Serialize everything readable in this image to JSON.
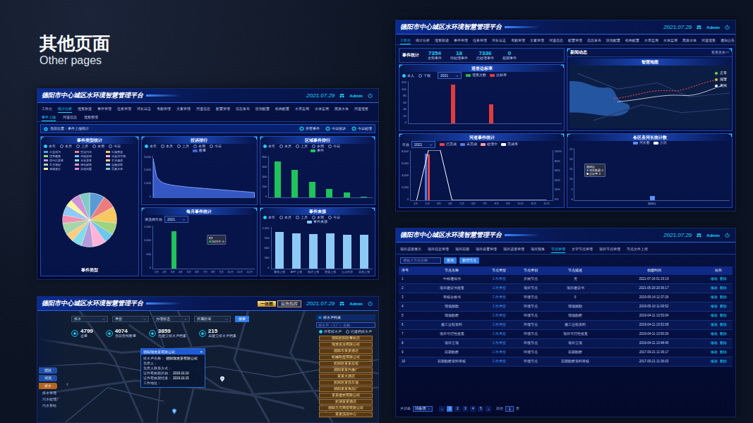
{
  "slide": {
    "title": "其他页面",
    "subtitle": "Other pages"
  },
  "platform": {
    "title": "德阳市中心城区水环境智慧管理平台",
    "date": "2021.07.29",
    "user": "Admin"
  },
  "screen_a": {
    "nav": [
      {
        "label": "工作台",
        "selected": false
      },
      {
        "label": "统计分析",
        "selected": true
      },
      {
        "label": "巡查轨迹",
        "selected": false
      },
      {
        "label": "事件管理",
        "selected": false
      },
      {
        "label": "任务管理",
        "selected": false
      },
      {
        "label": "河长日志",
        "selected": false
      },
      {
        "label": "考勤管理",
        "selected": false
      },
      {
        "label": "文案管理",
        "selected": false
      },
      {
        "label": "河道信息",
        "selected": false
      },
      {
        "label": "配置管理",
        "selected": false
      },
      {
        "label": "信息发布",
        "selected": false
      },
      {
        "label": "区划配置",
        "selected": false
      },
      {
        "label": "机构配置",
        "selected": false
      },
      {
        "label": "水质监测",
        "selected": false
      },
      {
        "label": "水体监测",
        "selected": false
      },
      {
        "label": "黑臭水体",
        "selected": false
      },
      {
        "label": "河道巡查",
        "selected": false
      }
    ],
    "subtabs": [
      {
        "label": "事件上报",
        "selected": true
      },
      {
        "label": "河道信息",
        "selected": false
      },
      {
        "label": "巡查整理",
        "selected": false
      }
    ],
    "breadcrumb": "当前位置：事件上报统计",
    "actions": [
      "所有事件",
      "今日投诉",
      "今日处理"
    ],
    "type_panel": {
      "title": "事件类型统计",
      "radios": [
        {
          "label": "本年",
          "selected": true
        },
        {
          "label": "本月",
          "selected": false
        },
        {
          "label": "上月",
          "selected": false
        },
        {
          "label": "本周",
          "selected": false
        },
        {
          "label": "今日",
          "selected": false
        }
      ],
      "caption": "事件类型",
      "slices": [
        {
          "label": "工业排污",
          "value": 9,
          "color": "#5b9bd5"
        },
        {
          "label": "生活污水",
          "value": 8,
          "color": "#ed7d7d"
        },
        {
          "label": "垃圾堆放",
          "value": 10,
          "color": "#f6c85f"
        },
        {
          "label": "违章建筑",
          "value": 7,
          "color": "#9fd47b"
        },
        {
          "label": "河道淤积",
          "value": 6,
          "color": "#6dc8ec"
        },
        {
          "label": "水面漂浮物",
          "value": 8,
          "color": "#ffb3d9"
        },
        {
          "label": "排污口异常",
          "value": 7,
          "color": "#b39ddb"
        },
        {
          "label": "水质异常",
          "value": 6,
          "color": "#80deea"
        },
        {
          "label": "非法捕捞",
          "value": 5,
          "color": "#ffcc80"
        },
        {
          "label": "非法采砂",
          "value": 7,
          "color": "#a5d6a7"
        },
        {
          "label": "绿化破坏",
          "value": 5,
          "color": "#f48fb1"
        },
        {
          "label": "设施损坏",
          "value": 6,
          "color": "#90caf9"
        },
        {
          "label": "岸线侵占",
          "value": 4,
          "color": "#fff59d"
        },
        {
          "label": "其他问题",
          "value": 6,
          "color": "#ce93d8"
        },
        {
          "label": "黑臭水体",
          "value": 6,
          "color": "#80cbc4"
        }
      ]
    },
    "rank_panel": {
      "title": "投诉排行",
      "radios": [
        {
          "label": "本年",
          "selected": true
        },
        {
          "label": "本月",
          "selected": false
        },
        {
          "label": "上月",
          "selected": false
        },
        {
          "label": "本周",
          "selected": false
        },
        {
          "label": "今日",
          "selected": false
        }
      ],
      "legend": [
        {
          "label": "数量",
          "color": "#3d63d8"
        }
      ],
      "y_ticks": [
        "3,000",
        "2,000",
        "1,000",
        "0"
      ],
      "values": [
        2800,
        1500,
        1200,
        1050,
        980,
        920,
        880,
        850,
        820,
        790,
        760,
        740,
        720,
        700,
        680,
        660,
        640,
        620,
        600,
        580,
        560,
        540,
        520,
        500,
        480,
        460,
        440,
        420,
        400,
        380
      ]
    },
    "region_panel": {
      "title": "区域事件排行",
      "radios": [
        {
          "label": "本年",
          "selected": true
        },
        {
          "label": "本月",
          "selected": false
        },
        {
          "label": "上月",
          "selected": false
        },
        {
          "label": "本周",
          "selected": false
        },
        {
          "label": "今日",
          "selected": false
        }
      ],
      "legend": [
        {
          "label": "事件",
          "color": "#1ec35b"
        }
      ],
      "y_ticks": [
        "800",
        "600",
        "400",
        "200",
        "0"
      ],
      "values": [
        690,
        520,
        300,
        160,
        90,
        20
      ]
    },
    "month_panel": {
      "title": "每月事件统计",
      "select_label": "请选择年份",
      "select_value": "2021",
      "y_ticks": [
        "1,500",
        "1,000",
        "500",
        "0"
      ],
      "months": [
        "1月",
        "2月",
        "3月",
        "4月",
        "5月",
        "6月",
        "7月",
        "8月",
        "9月",
        "10月",
        "11月",
        "12月"
      ],
      "values": [
        0,
        0,
        1300,
        0,
        0,
        0,
        0,
        0,
        0,
        0,
        0,
        0
      ],
      "tooltip": {
        "title": "8月",
        "text": "2021年: 0"
      }
    },
    "source_panel": {
      "title": "事件来源",
      "radios": [
        {
          "label": "本年",
          "selected": true
        },
        {
          "label": "本月",
          "selected": false
        },
        {
          "label": "上月",
          "selected": false
        },
        {
          "label": "本周",
          "selected": false
        },
        {
          "label": "今日",
          "selected": false
        }
      ],
      "legend": [
        {
          "label": "事件来源",
          "color": "#8ccaf5"
        }
      ],
      "y_ticks": [
        "1,200",
        "900",
        "600",
        "300",
        "0"
      ],
      "categories": [
        "微信上报",
        "APP上报",
        "电话上报",
        "巡查上报",
        "公众投诉",
        "其他上报"
      ],
      "values": [
        1050,
        1000,
        980,
        1000,
        970,
        960
      ]
    }
  },
  "screen_b": {
    "nav": [
      {
        "label": "工作台",
        "selected": true
      },
      {
        "label": "统计分析",
        "selected": false
      },
      {
        "label": "巡查轨迹",
        "selected": false
      },
      {
        "label": "事件管理",
        "selected": false
      },
      {
        "label": "任务管理",
        "selected": false
      },
      {
        "label": "河长日志",
        "selected": false
      },
      {
        "label": "考勤管理",
        "selected": false
      },
      {
        "label": "文案管理",
        "selected": false
      },
      {
        "label": "河道信息",
        "selected": false
      },
      {
        "label": "配置管理",
        "selected": false
      },
      {
        "label": "信息发布",
        "selected": false
      },
      {
        "label": "区划配置",
        "selected": false
      },
      {
        "label": "机构配置",
        "selected": false
      },
      {
        "label": "水质监测",
        "selected": false
      },
      {
        "label": "水体监测",
        "selected": false
      },
      {
        "label": "黑臭水体",
        "selected": false
      },
      {
        "label": "河道巡查",
        "selected": false
      },
      {
        "label": "通知公告",
        "selected": false
      }
    ],
    "stats": {
      "title": "事件统计",
      "items": [
        {
          "value": "7354",
          "label": "全部事件"
        },
        {
          "value": "18",
          "label": "待处理事件"
        },
        {
          "value": "7336",
          "label": "已处理事件"
        },
        {
          "value": "0",
          "label": "超期事件"
        }
      ]
    },
    "patrol": {
      "title": "巡查达标率",
      "radios": [
        {
          "label": "本人",
          "selected": true
        },
        {
          "label": "下级",
          "selected": false
        }
      ],
      "select_value": "2021",
      "legend": [
        {
          "label": "巡查次数",
          "color": "#2fb344"
        },
        {
          "label": "达标率",
          "color": "#e23b3b"
        }
      ],
      "y_ticks": [
        "120",
        "100",
        "80",
        "60",
        "40",
        "20",
        "0"
      ],
      "values": [
        0,
        0,
        0,
        110,
        0,
        0,
        55,
        0,
        0,
        0,
        0,
        0
      ]
    },
    "news": {
      "title": "新闻动态",
      "more": "查看更多>>"
    },
    "map": {
      "title": "智慧地图",
      "legend": [
        {
          "label": "正常",
          "color": "#7cd23c"
        },
        {
          "label": "报警",
          "color": "#e7b34a"
        },
        {
          "label": "离线",
          "color": "#ffffff"
        }
      ]
    },
    "river": {
      "title": "河道事件统计",
      "select_label": "年份",
      "select_value": "2021",
      "legend": [
        {
          "label": "已完成",
          "color": "#e8454a"
        },
        {
          "label": "未完成",
          "color": "#4f7be8"
        },
        {
          "label": "处理中",
          "color": "#ff9aa5"
        },
        {
          "label": "完成率",
          "color": "#ffffff"
        }
      ],
      "y_ticks": [
        "8,000",
        "6,000",
        "4,000",
        "2,000",
        "0"
      ],
      "y2_ticks": [
        "100%",
        "80%",
        "60%",
        "40%",
        "20%",
        "0%"
      ],
      "months": [
        "1月",
        "2月",
        "3月",
        "4月",
        "5月",
        "6月",
        "7月",
        "8月",
        "9月",
        "10月",
        "11月",
        "12月"
      ],
      "done": [
        0,
        7300,
        0,
        0,
        0,
        0,
        0,
        0,
        0,
        0,
        0,
        0
      ],
      "pending": [
        0,
        7400,
        0,
        0,
        0,
        0,
        0,
        0,
        0,
        0,
        0,
        0
      ],
      "processing": [
        0,
        0,
        0,
        0,
        0,
        0,
        0,
        0,
        0,
        0,
        0,
        0
      ],
      "rate": [
        0,
        100,
        100,
        0,
        0,
        0,
        0,
        0,
        0,
        0,
        0,
        0
      ]
    },
    "district": {
      "title": "各区县河长统计数",
      "legend": [
        {
          "label": "河长数",
          "color": "#5b8ff9"
        },
        {
          "label": "占比",
          "color": "#ffffff"
        }
      ],
      "y_ticks": [
        "25",
        "20",
        "15",
        "10",
        "5",
        "0"
      ],
      "categories": [
        "旌阳区"
      ],
      "values": [
        2
      ],
      "tooltip": {
        "title": "旌阳区",
        "lines": [
          "河长数量: 2",
          "占比率: 2"
        ]
      }
    }
  },
  "screen_c": {
    "tabs": [
      {
        "label": "项目进度展示",
        "selected": false
      },
      {
        "label": "项目信息管理",
        "selected": false
      },
      {
        "label": "项目前期",
        "selected": false
      },
      {
        "label": "项目设置管理",
        "selected": false
      },
      {
        "label": "项目进度管理",
        "selected": false
      },
      {
        "label": "项目预算",
        "selected": false
      },
      {
        "label": "节点管理",
        "selected": true
      },
      {
        "label": "文字节点管理",
        "selected": false
      },
      {
        "label": "项目节点管理",
        "selected": false
      },
      {
        "label": "节点文件上传",
        "selected": false
      }
    ],
    "search": {
      "placeholder": "请输入节点名称",
      "buttons": [
        "查询",
        "新增节点"
      ]
    },
    "table": {
      "columns": [
        "序号",
        "节点名称",
        "节点类型",
        "节点类别",
        "节点描述",
        "创建时间",
        "操作"
      ],
      "rows": [
        {
          "cells": [
            "1",
            "中标通知书",
            "工作类型",
            "开始节点",
            "无",
            "2021-07-16 01:19:19"
          ],
          "actions": [
            "修改",
            "删除"
          ]
        },
        {
          "cells": [
            "2",
            "项目建议书批复",
            "工作类型",
            "项目节点",
            "项目建议书",
            "2021-05-29 20:36:17"
          ],
          "actions": [
            "修改",
            "删除"
          ]
        },
        {
          "cells": [
            "3",
            "审核合格书",
            "工作类型",
            "环境节点",
            "0",
            "2019-05-14 11:37:26"
          ],
          "actions": [
            "修改",
            "删除"
          ]
        },
        {
          "cells": [
            "4",
            "现场踏勘",
            "工作类型",
            "环境节点",
            "现场踏勘",
            "2019-05-10 11:09:52"
          ],
          "actions": [
            "修改",
            "删除"
          ]
        },
        {
          "cells": [
            "5",
            "现场勘察",
            "工作类型",
            "环境节点",
            "现场勘察",
            "2019-04-11 13:53:04"
          ],
          "actions": [
            "修改",
            "删除"
          ]
        },
        {
          "cells": [
            "6",
            "施工过程资料",
            "工作类型",
            "环境节点",
            "施工过程资料",
            "2019-04-11 13:52:08"
          ],
          "actions": [
            "修改",
            "删除"
          ]
        },
        {
          "cells": [
            "7",
            "项目可行性批复",
            "工作类型",
            "环境节点",
            "项目可行性批复",
            "2019-04-11 13:50:26"
          ],
          "actions": [
            "修改",
            "删除"
          ]
        },
        {
          "cells": [
            "8",
            "项目立项",
            "工作类型",
            "环境节点",
            "项目立项",
            "2019-04-11 13:48:45"
          ],
          "actions": [
            "修改",
            "删除"
          ]
        },
        {
          "cells": [
            "9",
            "前期勘察",
            "工作类型",
            "环境节点",
            "前期勘察",
            "2017-09-21 11:36:17"
          ],
          "actions": [
            "修改",
            "删除"
          ]
        },
        {
          "cells": [
            "10",
            "前期勘察资料审核",
            "工作类型",
            "环境节点",
            "前期勘察资料审核",
            "2017-09-21 11:36:03"
          ],
          "actions": [
            "修改",
            "删除"
          ]
        }
      ]
    },
    "pagination": {
      "total": "共10条",
      "page_size": "10条/页",
      "prev": "‹",
      "next": "›",
      "pages": [
        {
          "label": "1",
          "selected": true
        },
        {
          "label": "2",
          "selected": false
        },
        {
          "label": "3",
          "selected": false
        },
        {
          "label": "4",
          "selected": false
        },
        {
          "label": "5",
          "selected": false
        }
      ],
      "goto": "前往",
      "page_input": "1",
      "page_unit": "页"
    }
  },
  "screen_d": {
    "header_tabs": [
      {
        "label": "一张图",
        "selected": true
      },
      {
        "label": "应急指挥",
        "selected": false
      }
    ],
    "filters": [
      "排水",
      "类型",
      "办理状态",
      "所属区域"
    ],
    "search_button": "搜索",
    "stats": [
      {
        "value": "4799",
        "label": "总量"
      },
      {
        "value": "4074",
        "label": "当前在线数量"
      },
      {
        "value": "3859",
        "label": "已建立排水户档案"
      },
      {
        "value": "215",
        "label": "未建立排水户档案"
      }
    ],
    "popup": {
      "title": "德阳瑞龙某有限公司",
      "close": "×",
      "rows": [
        {
          "label": "排水户名称：",
          "value": "德阳瑞龙某有限公司"
        },
        {
          "label": "负责人："
        },
        {
          "label": "负责人联系方式："
        },
        {
          "label": "证件有效期开始：",
          "value": "2019.10.10"
        },
        {
          "label": "证件有效期结束：",
          "value": "2019.10.15"
        },
        {
          "label": "工作地址："
        }
      ]
    },
    "list": {
      "title": "排水户列表",
      "search_placeholder": "排水户（工厂）名称",
      "radios": [
        {
          "label": "所有排水户",
          "selected": true
        },
        {
          "label": "已建档排水户",
          "selected": false
        }
      ],
      "items": [
        "德阳旌阳区餐饮店",
        "瑞龙实业有限公司",
        "德阳市某某酒店",
        "机械制造有限公司",
        "旌阳区某某宾馆",
        "德阳某某汽修厂",
        "某某大酒店",
        "旌阳区某洗车场",
        "德阳某某食品厂",
        "某某建材有限公司",
        "旌湖某某酒店",
        "德阳天元商贸有限公司",
        "某某洗浴中心"
      ]
    },
    "sidebar": {
      "toggle": "‹",
      "items": [
        {
          "label": "辖区",
          "selected": false
        },
        {
          "label": "河流",
          "selected": false
        },
        {
          "label": "排水",
          "selected": true
        }
      ],
      "sub_items": [
        "排水管理",
        "污水处理厂",
        "污水泵站"
      ]
    }
  }
}
